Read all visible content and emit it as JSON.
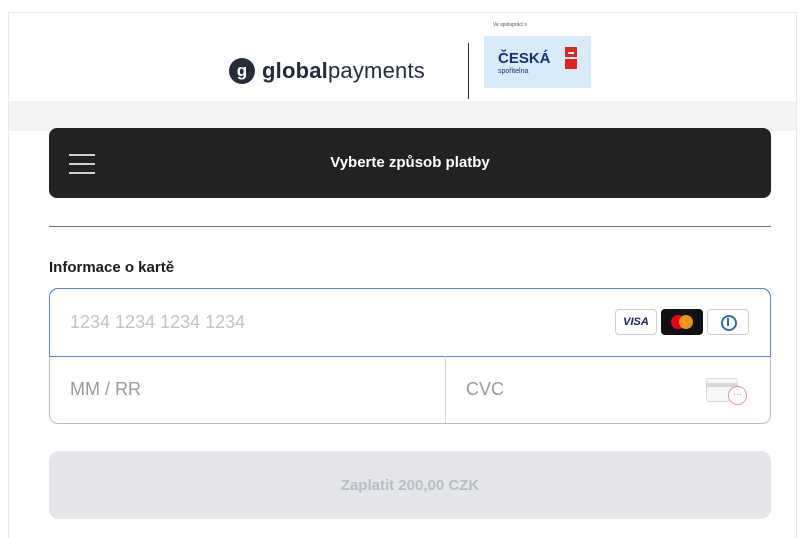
{
  "header": {
    "brand_mark": "g",
    "brand_bold": "global",
    "brand_light": "payments",
    "partner_tagline": "Ve spolupráci s",
    "partner_name": "ČESKÁ",
    "partner_sub": "spořitelna"
  },
  "menu": {
    "title": "Vyberte způsob platby",
    "menu_icon": "hamburger-menu-icon"
  },
  "card_section": {
    "label": "Informace o kartě",
    "card_number_placeholder": "1234 1234 1234 1234",
    "expiry_placeholder": "MM / RR",
    "cvc_placeholder": "CVC",
    "brands": [
      "VISA",
      "Mastercard",
      "Diners Club"
    ]
  },
  "pay_button": {
    "label": "Zaplatit 200,00 CZK"
  },
  "colors": {
    "menu_bg": "#222222",
    "pay_button_bg": "#e5e6ea",
    "pay_button_text": "#b9bcc7",
    "active_border": "#5d87c8"
  }
}
